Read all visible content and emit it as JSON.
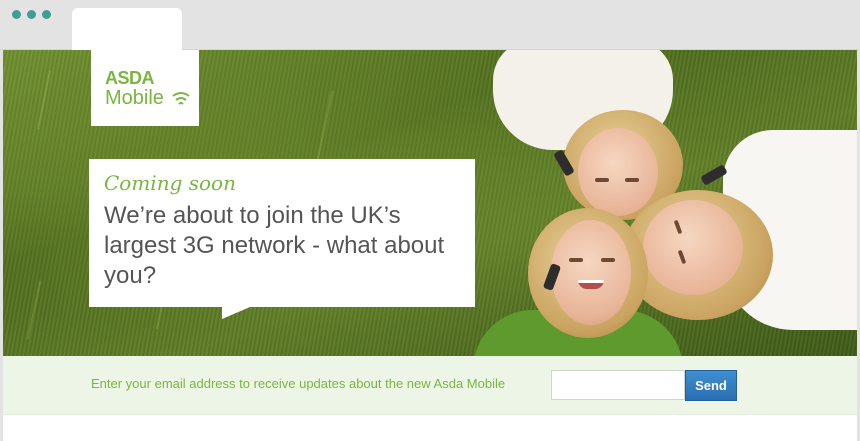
{
  "logo": {
    "brand": "ASDA",
    "product": "Mobile"
  },
  "hero": {
    "kicker": "Coming soon",
    "headline": "We’re about to join the UK’s largest 3G network - what about you?"
  },
  "signup": {
    "prompt": "Enter your email address to receive updates about the new Asda Mobile",
    "email_placeholder": "",
    "send_label": "Send"
  },
  "colors": {
    "brand_green": "#7ab541",
    "button_blue": "#2f7fc4",
    "signup_background": "#edf6e6"
  },
  "icons": [
    "window-control-dot",
    "signal-waves-icon"
  ]
}
